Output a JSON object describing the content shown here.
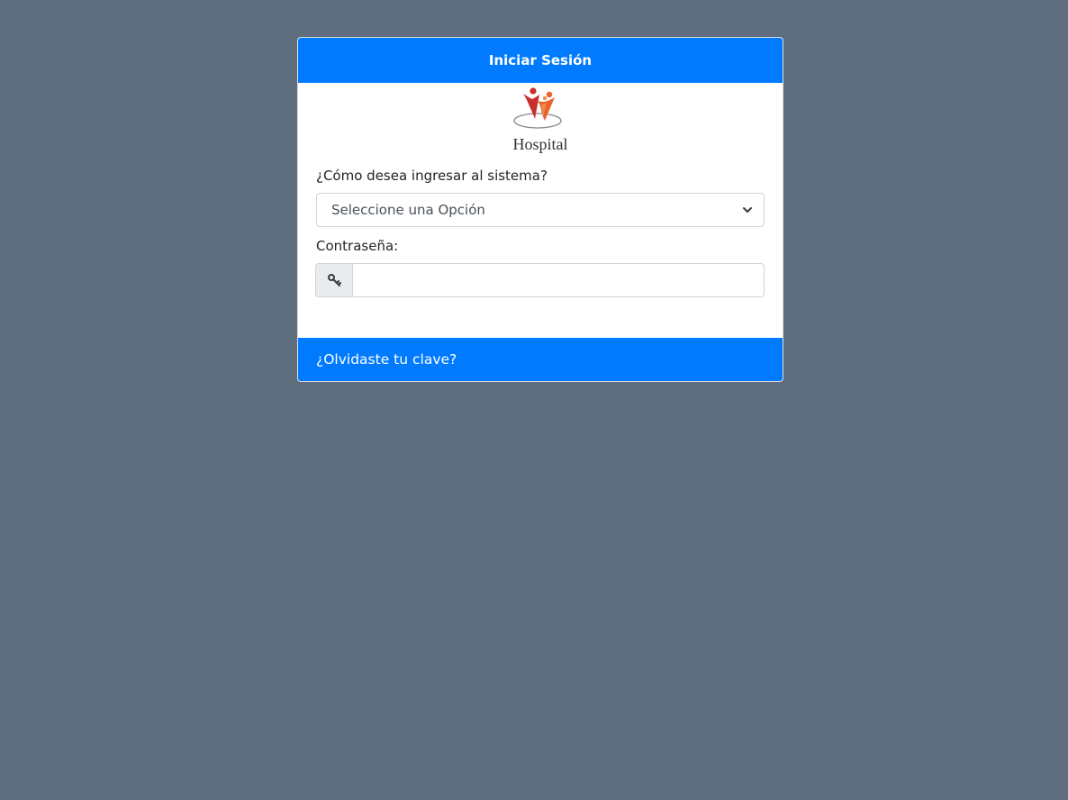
{
  "login": {
    "title": "Iniciar Sesión",
    "logo_text": "Hospital",
    "mode_label": "¿Cómo desea ingresar al sistema?",
    "mode_select_value": "Seleccione una Opción",
    "password_label": "Contraseña:",
    "password_value": "",
    "forgot_link": "¿Olvidaste tu clave?"
  },
  "icons": {
    "key": "key-icon",
    "chevron": "chevron-down-icon"
  },
  "colors": {
    "page_background": "#5f6e7e",
    "primary": "#007bff",
    "logo_red": "#c9302c",
    "logo_orange": "#e8622a"
  }
}
